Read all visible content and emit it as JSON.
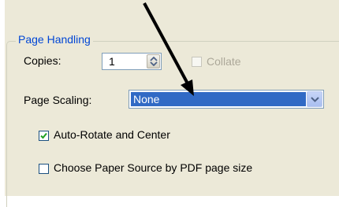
{
  "group": {
    "title": "Page Handling"
  },
  "copies": {
    "label": "Copies:",
    "value": "1"
  },
  "collate": {
    "label": "Collate",
    "checked": false,
    "enabled": false
  },
  "page_scaling": {
    "label": "Page Scaling:",
    "selected": "None"
  },
  "auto_rotate": {
    "label": "Auto-Rotate and Center",
    "checked": true
  },
  "paper_source": {
    "label": "Choose Paper Source by PDF page size",
    "checked": false
  }
}
